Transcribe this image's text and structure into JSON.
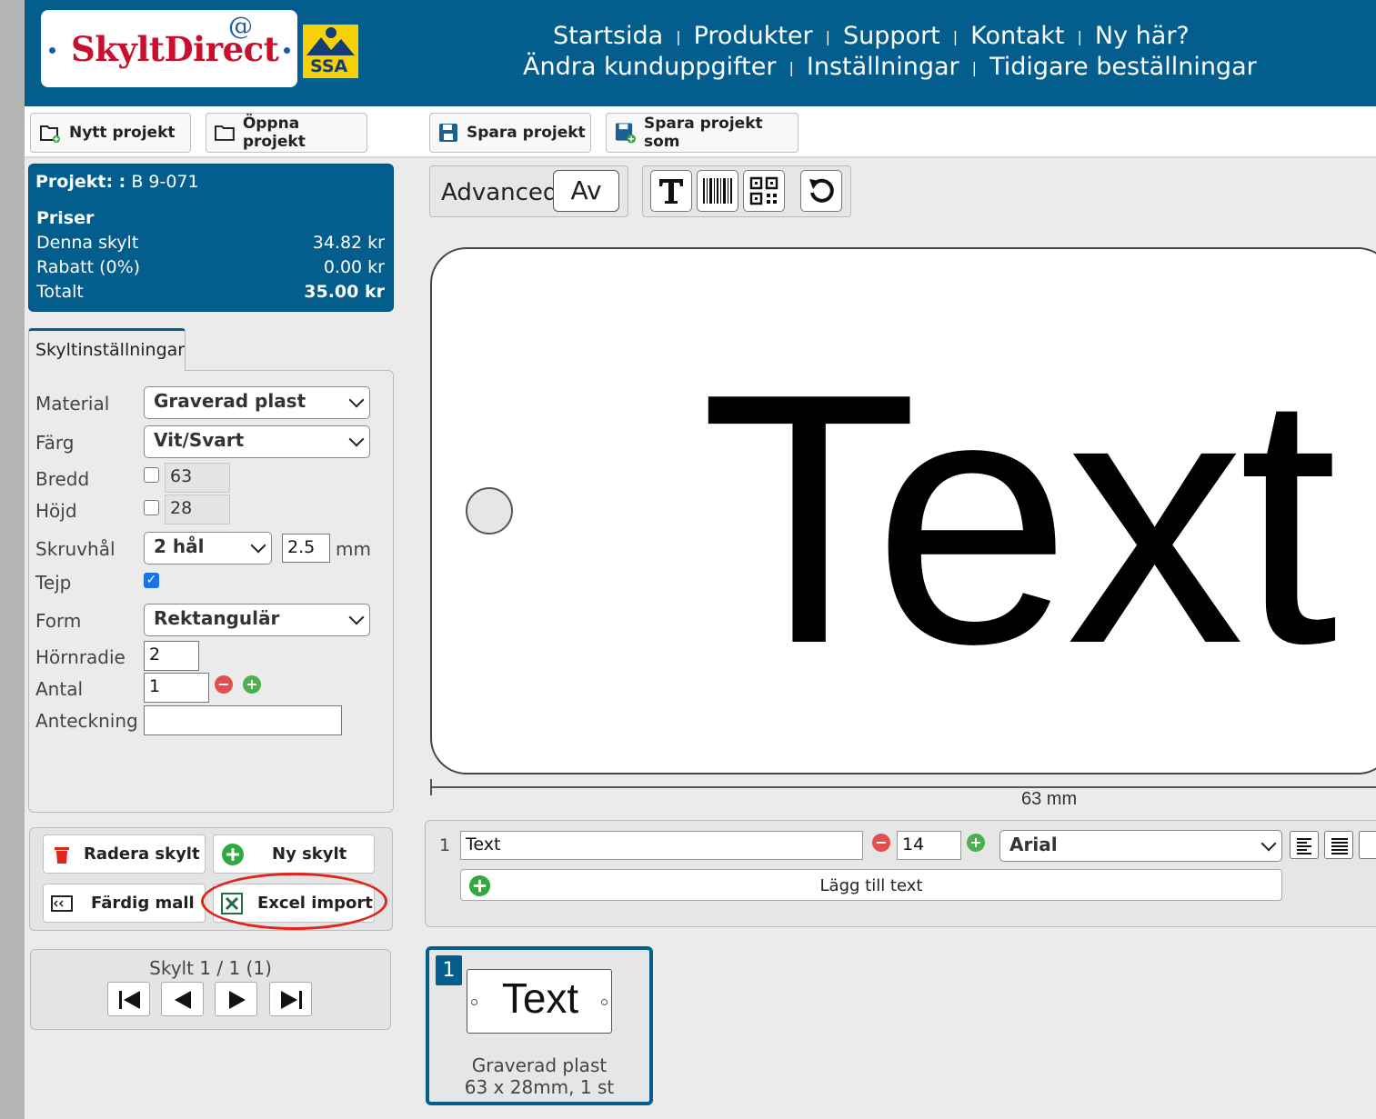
{
  "header": {
    "logo_text": "SkyltDirect",
    "logo_at": "@",
    "partner_logo": "SSA",
    "nav_row1": [
      "Startsida",
      "Produkter",
      "Support",
      "Kontakt",
      "Ny här?"
    ],
    "nav_row2": [
      "Ändra kunduppgifter",
      "Inställningar",
      "Tidigare beställningar"
    ],
    "separator": "|"
  },
  "toolbar": {
    "new_project": "Nytt projekt",
    "open_project": "Öppna projekt",
    "save_project": "Spara projekt",
    "save_project_as": "Spara projekt som"
  },
  "project": {
    "label": "Projekt: :",
    "name": "B 9-071",
    "prices_heading": "Priser",
    "rows": [
      {
        "label": "Denna skylt",
        "value": "34.82 kr"
      },
      {
        "label": "Rabatt (0%)",
        "value": "0.00 kr"
      }
    ],
    "total_label": "Totalt",
    "total_value": "35.00 kr"
  },
  "settings": {
    "tab": "Skyltinställningar",
    "material_label": "Material",
    "material_value": "Graverad plast",
    "color_label": "Färg",
    "color_value": "Vit/Svart",
    "width_label": "Bredd",
    "width_value": "63",
    "height_label": "Höjd",
    "height_value": "28",
    "screw_label": "Skruvhål",
    "screw_value": "2 hål",
    "screw_size": "2.5",
    "screw_unit": "mm",
    "tape_label": "Tejp",
    "tape_checked": true,
    "shape_label": "Form",
    "shape_value": "Rektangulär",
    "radius_label": "Hörnradie",
    "radius_value": "2",
    "qty_label": "Antal",
    "qty_value": "1",
    "note_label": "Anteckning",
    "note_value": ""
  },
  "actions": {
    "delete": "Radera skylt",
    "new_sign": "Ny skylt",
    "template": "Färdig mall",
    "excel_import": "Excel import"
  },
  "pager": {
    "label": "Skylt 1 / 1 (1)"
  },
  "editor": {
    "advanced_label": "Advanced",
    "advanced_value": "Av",
    "sign_text": "Text",
    "width_readout": "63 mm"
  },
  "text_rows": {
    "row_number": "1",
    "text_value": "Text",
    "size_value": "14",
    "font_value": "Arial",
    "add_text": "Lägg till text"
  },
  "thumbnail": {
    "number": "1",
    "text": "Text",
    "line1": "Graverad plast",
    "line2": "63 x 28mm, 1 st"
  },
  "colors": {
    "brand_blue": "#035e8e",
    "brand_red": "#c8102e",
    "highlight": "#e0261b"
  }
}
